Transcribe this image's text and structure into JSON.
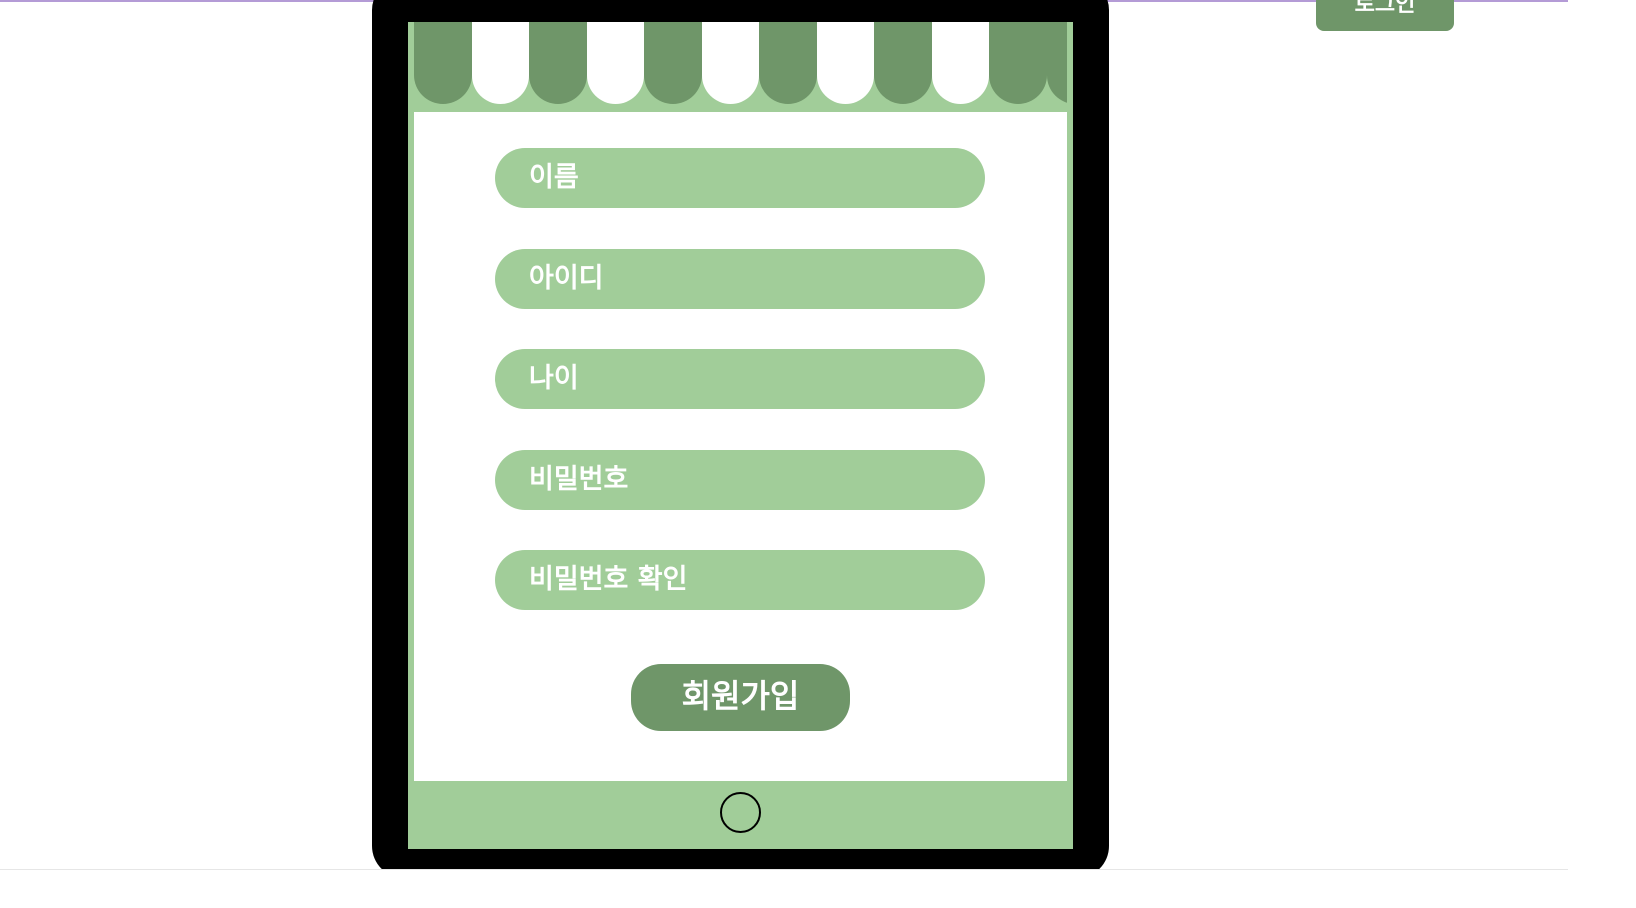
{
  "header": {
    "login_label": "로그인"
  },
  "form": {
    "fields": [
      {
        "placeholder": "이름"
      },
      {
        "placeholder": "아이디"
      },
      {
        "placeholder": "나이"
      },
      {
        "placeholder": "비밀번호"
      },
      {
        "placeholder": "비밀번호 확인"
      }
    ],
    "submit_label": "회원가입"
  },
  "colors": {
    "accent_dark": "#6f9669",
    "accent_light": "#a1cd99",
    "frame": "#000000",
    "screen": "#ffffff"
  },
  "icons": {
    "home": "home-button-icon"
  }
}
